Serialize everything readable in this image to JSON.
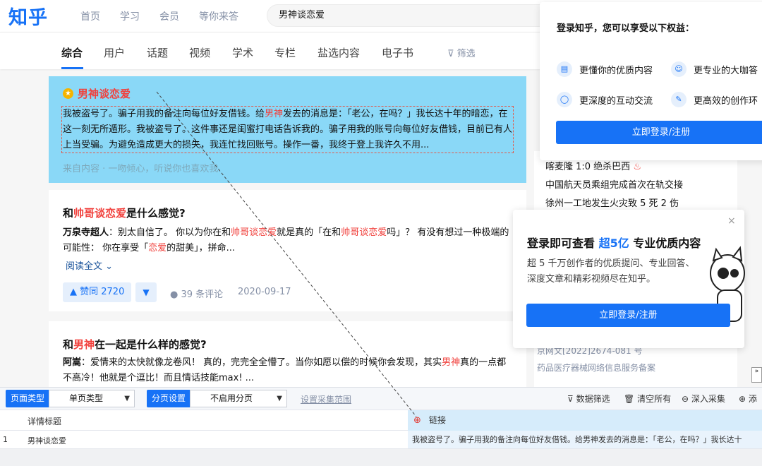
{
  "app": {
    "logo": "知乎",
    "nav": [
      "首页",
      "学习",
      "会员",
      "等你来答"
    ],
    "search_value": "男神谈恋爱"
  },
  "tabs": [
    "综合",
    "用户",
    "话题",
    "视频",
    "学术",
    "专栏",
    "盐选内容",
    "电子书"
  ],
  "filter_label": "筛选",
  "highlight": {
    "title": "男神谈恋爱",
    "body_pre": "我被盗号了。骗子用我的备注向每位好友借钱。给",
    "body_red": "男神",
    "body_post": "发去的消息是：「老公，在吗？」我长达十年的暗恋，在这一刻无所遁形。我被盗号了。这件事还是闺蜜打电话告诉我的。骗子用我的账号向每位好友借钱，目前已有人上当受骗。为避免造成更大的损失，我连忙找回账号。操作一番，我终于登上我许久不用...",
    "source": "来自内容 · 一吻倾心，听说你也喜欢我"
  },
  "q1": {
    "title_pre": "和",
    "title_red": "帅哥谈恋爱",
    "title_post": "是什么感觉?",
    "author": "万泉寺超人",
    "body_a": "：别太自信了。 你以为你在和",
    "body_red1": "帅哥谈恋爱",
    "body_b": "就是真的「在和",
    "body_red2": "帅哥谈恋爱",
    "body_c": "吗」？ 有没有想过一种极端的可能性： 你在享受「",
    "body_red3": "恋爱",
    "body_d": "的甜美」，拼命...",
    "read_more": "阅读全文 ⌄",
    "vote": "▲ 赞同 2720",
    "vote_down": "▼",
    "comments": "● 39 条评论",
    "date": "2020-09-17"
  },
  "q2": {
    "title_pre": "和",
    "title_red": "男神",
    "title_post": "在一起是什么样的感觉?",
    "author": "阿嵩",
    "body_a": "：爱情来的太快就像龙卷风！ 真的，完完全全懵了。当你如愿以偿的时候你会发现，其实",
    "body_red": "男神",
    "body_b": "真的一点都不高冷！他就是个逗比！而且情话技能max! ..."
  },
  "hot_list": [
    "喀麦隆 1:0 绝杀巴西",
    "中国航天员乘组完成首次在轨交接",
    "徐州一工地发生火灾致 5 死 2 伤"
  ],
  "login_popup": {
    "title": "登录知乎，您可以享受以下权益：",
    "benefits": [
      "更懂你的优质内容",
      "更专业的大咖答",
      "更深度的互动交流",
      "更高效的创作环"
    ],
    "button": "立即登录/注册"
  },
  "login_popup2": {
    "title_pre": "登录即可查看 ",
    "title_blue": "超5亿",
    "title_post": " 专业优质内容",
    "desc": "超 5 千万创作者的优质提问、专业回答、深度文章和精彩视频尽在知乎。",
    "button": "立即登录/注册",
    "close": "×"
  },
  "footer_lines": [
    "京网文[2022]2674-081 号",
    "药品医疗器械网络信息服务备案"
  ],
  "collector": {
    "page_type_label": "页面类型",
    "page_type_value": "单页类型",
    "paging_label": "分页设置",
    "paging_value": "不启用分页",
    "set_range": "设置采集范围",
    "tools": [
      "数据筛选",
      "清空所有",
      "深入采集",
      "添"
    ],
    "columns": [
      "详情标题",
      "链接"
    ],
    "rows": [
      {
        "num": "1",
        "title": "男神谈恋爱",
        "link": "我被盗号了。骗子用我的备注向每位好友借钱。给男神发去的消息是：「老公，在吗？」我长达十"
      }
    ]
  },
  "colors": {
    "brand": "#1772f6",
    "highlight_bg": "#8ad8f7",
    "red": "#f1403c"
  }
}
